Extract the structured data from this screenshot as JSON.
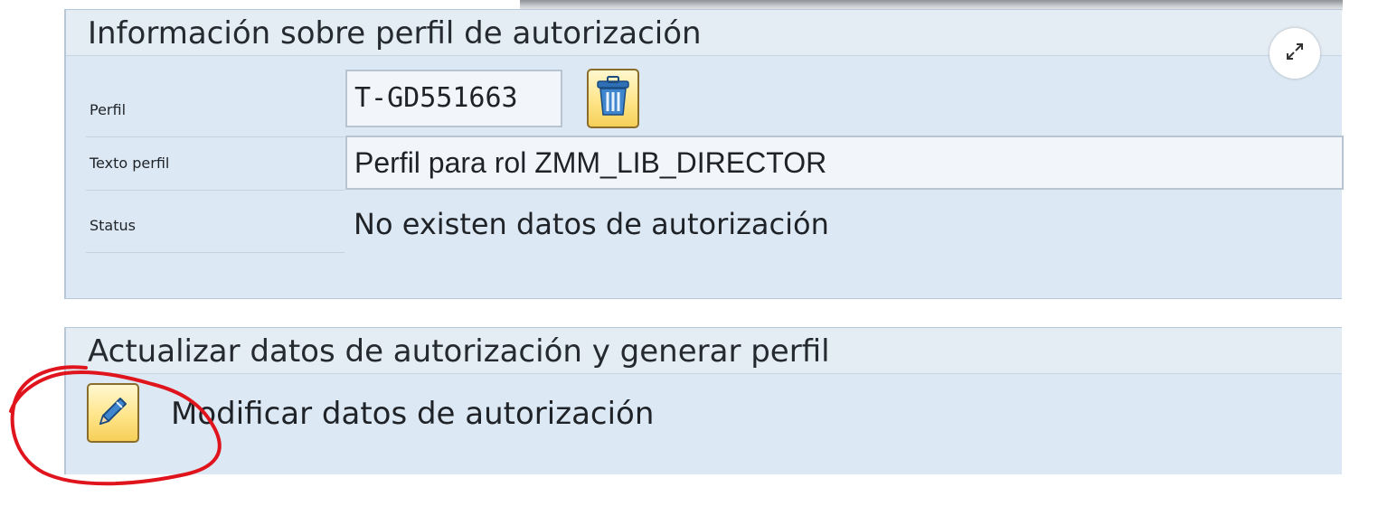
{
  "profile_info": {
    "header": "Información sobre perfil de autorización",
    "profile_label": "Perfil",
    "profile_value": "T-GD551663",
    "profile_text_label": "Texto perfil",
    "profile_text_value": "Perfil para rol ZMM_LIB_DIRECTOR",
    "status_label": "Status",
    "status_value": "No existen datos de autorización"
  },
  "auth_update": {
    "header": "Actualizar datos de autorización y generar perfil",
    "modify_label": "Modificar datos de autorización"
  },
  "icons": {
    "delete": "trash-icon",
    "modify": "pencil-icon",
    "expand": "expand-icon"
  },
  "colors": {
    "panel_background": "#dce8f3",
    "button_yellow": "#ffe58a",
    "annotation_red": "#e0141c"
  }
}
